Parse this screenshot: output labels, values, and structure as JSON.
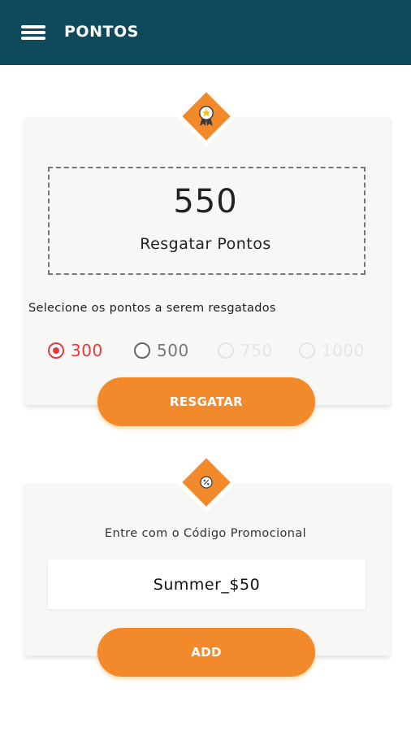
{
  "app_bar": {
    "title": "PONTOS",
    "menu_icon": "hamburger-menu-icon",
    "background_color": "#0f4a5c"
  },
  "redeem_card": {
    "badge_icon": "award-ribbon-icon",
    "points_value": "550",
    "points_label": "Resgatar Pontos",
    "select_label": "Selecione os pontos a serem resgatados",
    "options": [
      {
        "label": "300",
        "state": "selected"
      },
      {
        "label": "500",
        "state": "enabled"
      },
      {
        "label": "750",
        "state": "disabled"
      },
      {
        "label": "1000",
        "state": "disabled"
      }
    ],
    "button_label": "RESGATAR"
  },
  "promo_card": {
    "badge_icon": "percent-badge-icon",
    "label": "Entre com o Código Promocional",
    "code_value": "Summer_$50",
    "button_label": "ADD"
  },
  "colors": {
    "accent": "#f28a2c",
    "selected": "#e8393a",
    "card_background": "#f7f7f6"
  }
}
